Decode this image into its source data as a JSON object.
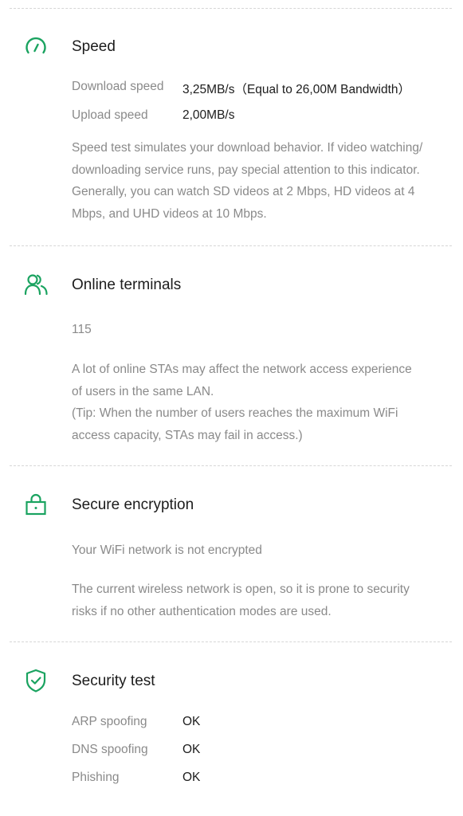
{
  "colors": {
    "accent_green": "#1aa360",
    "title_text": "#1c1c1c",
    "secondary_text": "#8a8a8a",
    "divider": "#d6d6d6"
  },
  "speed": {
    "icon": "speedometer-icon",
    "title": "Speed",
    "download_label": "Download speed",
    "download_value": "3,25MB/s（Equal to 26,00M Bandwidth）",
    "upload_label": "Upload speed",
    "upload_value": "2,00MB/s",
    "description": [
      "Speed test simulates your download behavior. If video watching/",
      "downloading service runs, pay special attention to this indicator.",
      "Generally, you can watch SD videos at 2 Mbps, HD videos at 4",
      "Mbps, and UHD videos at 10 Mbps."
    ]
  },
  "terminals": {
    "icon": "users-icon",
    "title": "Online terminals",
    "count": "115",
    "description": [
      "A lot of online STAs may affect the network access experience",
      "of users in the same LAN.",
      "(Tip: When the number of users reaches the maximum WiFi",
      "access capacity, STAs may fail in access.)"
    ]
  },
  "encryption": {
    "icon": "lock-icon",
    "title": "Secure encryption",
    "status": "Your WiFi network is not encrypted",
    "description": [
      "The current wireless network is open, so it is prone to security",
      "risks if no other authentication modes are used."
    ]
  },
  "security": {
    "icon": "shield-check-icon",
    "title": "Security test",
    "items": [
      {
        "label": "ARP spoofing",
        "value": "OK"
      },
      {
        "label": "DNS spoofing",
        "value": "OK"
      },
      {
        "label": "Phishing",
        "value": "OK"
      }
    ]
  }
}
